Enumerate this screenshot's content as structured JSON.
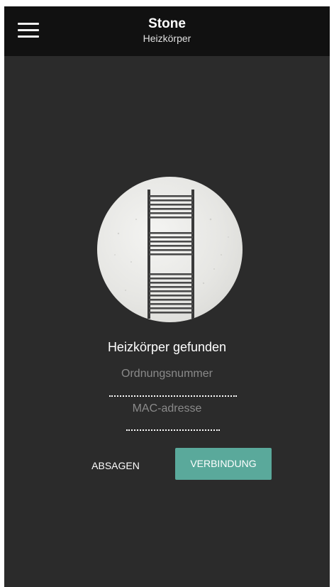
{
  "appbar": {
    "title": "Stone",
    "subtitle": "Heizkörper",
    "menu_icon": "hamburger-menu-icon"
  },
  "main": {
    "image_description": "radiator-image",
    "found_text": "Heizkörper gefunden",
    "serial": {
      "placeholder": "Ordnungsnummer",
      "value": ""
    },
    "mac": {
      "placeholder": "MAC-adresse",
      "value": ""
    }
  },
  "actions": {
    "cancel_label": "ABSAGEN",
    "connect_label": "VERBINDUNG"
  },
  "colors": {
    "background": "#2b2b2b",
    "appbar": "#111111",
    "accent": "#5aa99b"
  }
}
